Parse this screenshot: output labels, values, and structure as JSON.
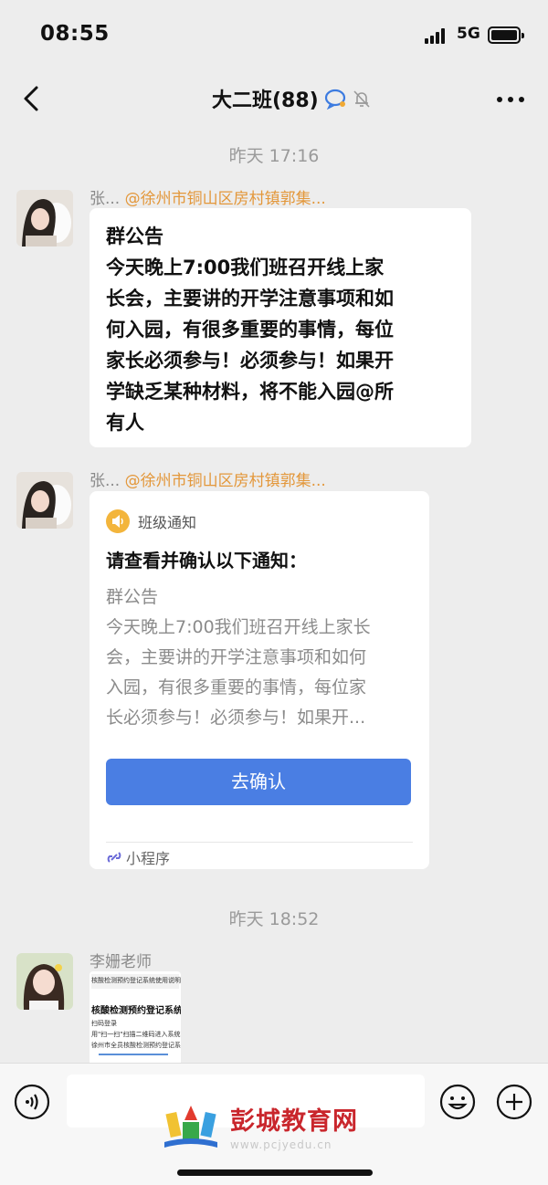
{
  "status_bar": {
    "time": "08:55",
    "network": "5G"
  },
  "nav": {
    "title": "大二班(88)"
  },
  "messages": {
    "timestamp_1": "昨天 17:16",
    "msg1": {
      "sender": "张...",
      "mention": "@徐州市铜山区房村镇郭集...",
      "lines": [
        "群公告",
        "今天晚上7:00我们班召开线上家",
        "长会，主要讲的开学注意事项和如",
        "何入园，有很多重要的事情，每位",
        "家长必须参与！必须参与！如果开",
        "学缺乏某种材料，将不能入园@所",
        "有人"
      ]
    },
    "msg2": {
      "sender": "张...",
      "mention": "@徐州市铜山区房村镇郭集...",
      "card_label": "班级通知",
      "card_title": "请查看并确认以下通知：",
      "card_lines": [
        "群公告",
        "今天晚上7:00我们班召开线上家长",
        "会，主要讲的开学注意事项和如何",
        "入园，有很多重要的事情，每位家",
        "长必须参与！必须参与！如果开..."
      ],
      "confirm_label": "去确认",
      "footer_label": "小程序"
    },
    "timestamp_2": "昨天 18:52",
    "msg3": {
      "sender": "李姗老师",
      "thumb_lines": [
        "核酸检测预约登记系统使用说明.pdf",
        "核酸检测预约登记系统使用",
        "扫码登录",
        "用\"扫一扫\"扫描二维码进入系统",
        "徐州市全员核酸检测预约登记系统"
      ]
    }
  },
  "watermark": {
    "name": "彭城教育网",
    "url": "www.pcjyedu.cn"
  },
  "colors": {
    "accent_blue": "#4a7ee3",
    "mention_orange": "#e3973a",
    "notice_yellow": "#f3b53c",
    "watermark_red": "#c9262c"
  },
  "icons": [
    "back-icon",
    "chat-ai-icon",
    "mute-bell-icon",
    "more-icon",
    "notice-megaphone-icon",
    "mini-program-link-icon",
    "voice-icon",
    "emoji-icon",
    "plus-icon"
  ]
}
